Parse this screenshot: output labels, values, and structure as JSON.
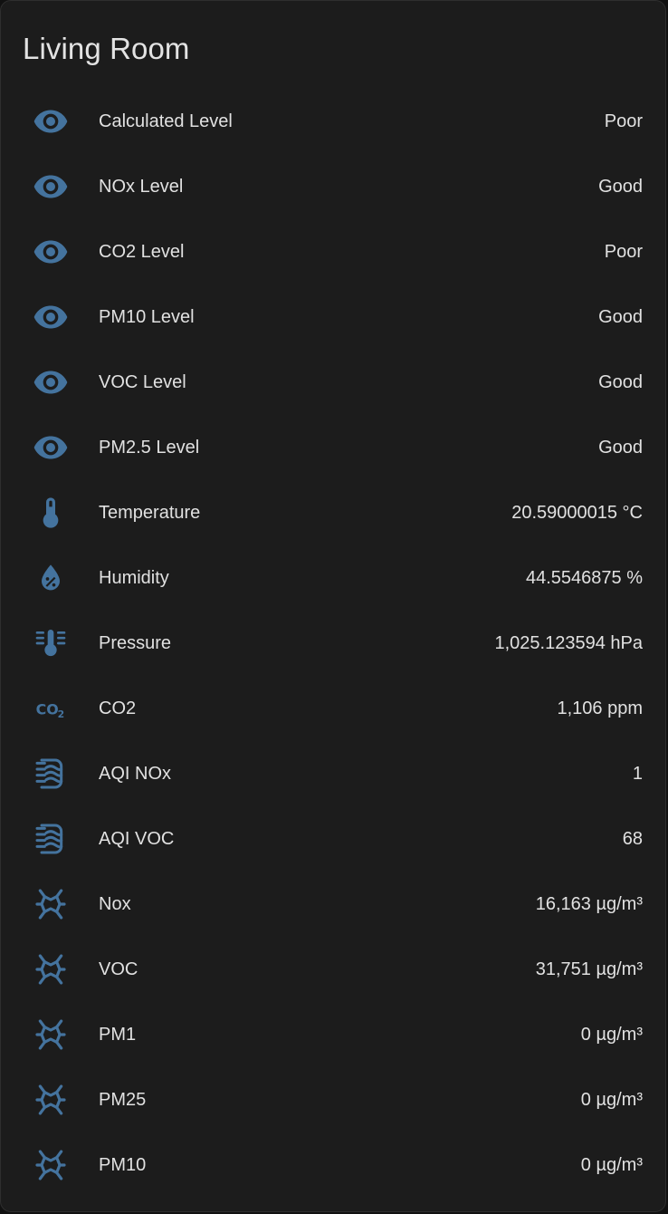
{
  "card": {
    "title": "Living Room",
    "icon_color": "#44739e",
    "rows": [
      {
        "icon": "eye-icon",
        "label": "Calculated Level",
        "value": "Poor"
      },
      {
        "icon": "eye-icon",
        "label": "NOx Level",
        "value": "Good"
      },
      {
        "icon": "eye-icon",
        "label": "CO2 Level",
        "value": "Poor"
      },
      {
        "icon": "eye-icon",
        "label": "PM10 Level",
        "value": "Good"
      },
      {
        "icon": "eye-icon",
        "label": "VOC Level",
        "value": "Good"
      },
      {
        "icon": "eye-icon",
        "label": "PM2.5 Level",
        "value": "Good"
      },
      {
        "icon": "thermometer-icon",
        "label": "Temperature",
        "value": "20.59000015 °C"
      },
      {
        "icon": "water-percent-icon",
        "label": "Humidity",
        "value": "44.5546875 %"
      },
      {
        "icon": "gauge-thermometer-icon",
        "label": "Pressure",
        "value": "1,025.123594 hPa"
      },
      {
        "icon": "co2-icon",
        "label": "CO2",
        "value": "1,106 ppm"
      },
      {
        "icon": "air-filter-icon",
        "label": "AQI NOx",
        "value": "1"
      },
      {
        "icon": "air-filter-icon",
        "label": "AQI VOC",
        "value": "68"
      },
      {
        "icon": "molecule-icon",
        "label": "Nox",
        "value": "16,163 µg/m³"
      },
      {
        "icon": "molecule-icon",
        "label": "VOC",
        "value": "31,751 µg/m³"
      },
      {
        "icon": "molecule-icon",
        "label": "PM1",
        "value": "0 µg/m³"
      },
      {
        "icon": "molecule-icon",
        "label": "PM25",
        "value": "0 µg/m³"
      },
      {
        "icon": "molecule-icon",
        "label": "PM10",
        "value": "0 µg/m³"
      }
    ]
  }
}
